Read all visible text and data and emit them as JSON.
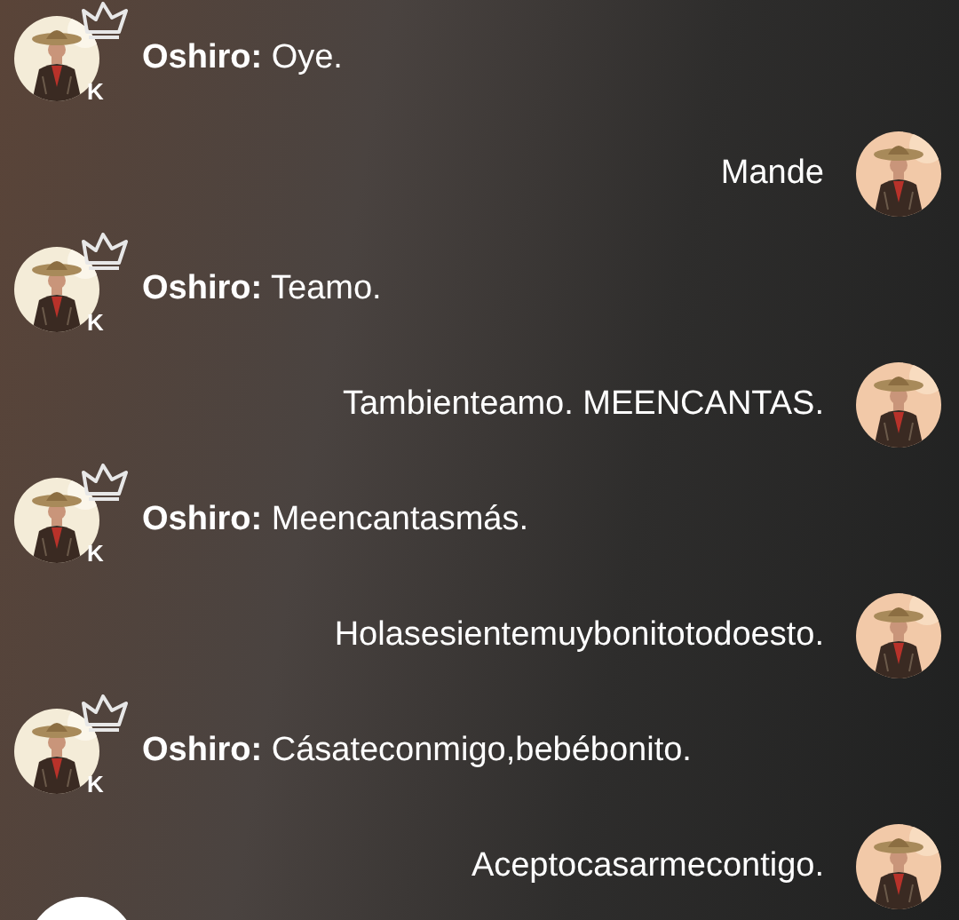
{
  "messages": [
    {
      "kind": "incoming",
      "sender": "Oshiro:",
      "text": "Oye.",
      "badge": "K"
    },
    {
      "kind": "outgoing",
      "text": "Mande"
    },
    {
      "kind": "incoming",
      "sender": "Oshiro:",
      "text": "Teamo.",
      "badge": "K"
    },
    {
      "kind": "outgoing",
      "text": "Tambienteamo. MEENCANTAS."
    },
    {
      "kind": "incoming",
      "sender": "Oshiro:",
      "text": "Meencantasmás.",
      "badge": "K"
    },
    {
      "kind": "outgoing",
      "text": "Holasesientemuybonitotodoesto."
    },
    {
      "kind": "incoming",
      "sender": "Oshiro:",
      "text": "Cásateconmigo,bebébonito.",
      "badge": "K"
    },
    {
      "kind": "outgoing",
      "text": "Aceptocasarmecontigo."
    }
  ]
}
